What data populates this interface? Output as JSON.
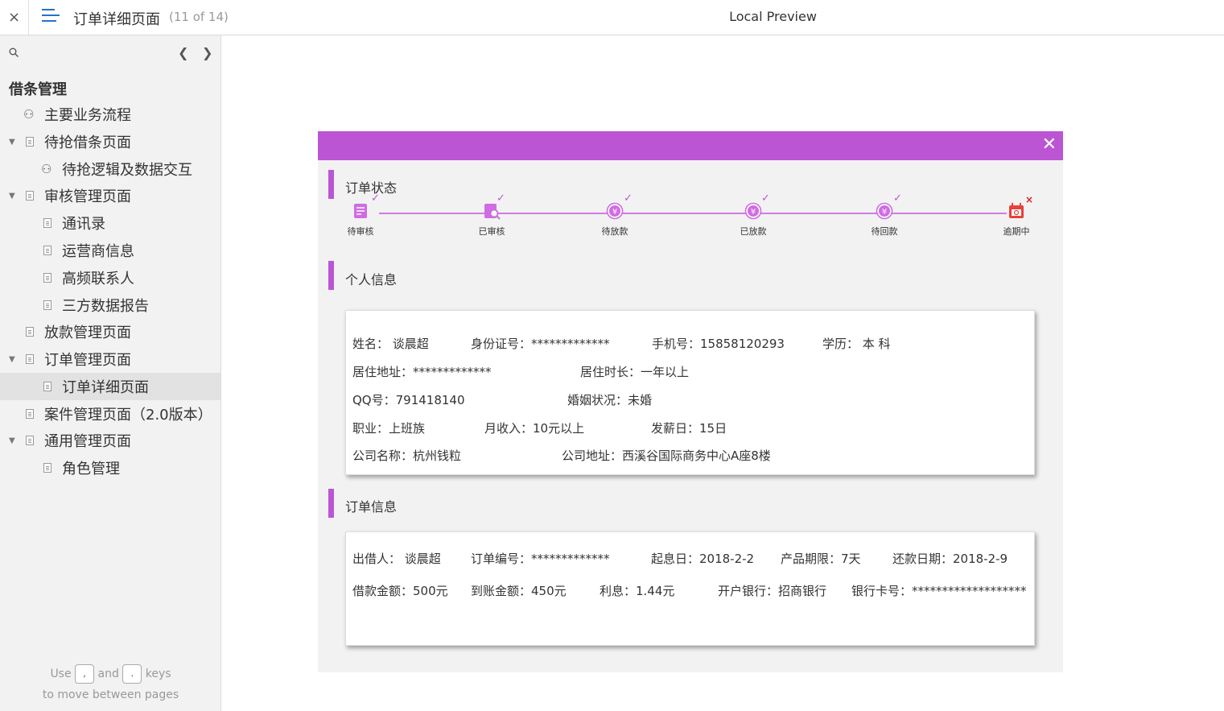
{
  "topbar": {
    "close": "×",
    "title": "订单详细页面",
    "count": "(11 of 14)",
    "preview_title": "Local Preview"
  },
  "sidebar": {
    "root": "借条管理",
    "items": [
      {
        "label": "主要业务流程"
      },
      {
        "label": "待抢借条页面"
      },
      {
        "label": "待抢逻辑及数据交互"
      },
      {
        "label": "审核管理页面"
      },
      {
        "label": "通讯录"
      },
      {
        "label": "运营商信息"
      },
      {
        "label": "高频联系人"
      },
      {
        "label": "三方数据报告"
      },
      {
        "label": "放款管理页面"
      },
      {
        "label": "订单管理页面"
      },
      {
        "label": "订单详细页面"
      },
      {
        "label": "案件管理页面（2.0版本）"
      },
      {
        "label": "通用管理页面"
      },
      {
        "label": "角色管理"
      }
    ],
    "hint": {
      "use": "Use",
      "key_prev": ",",
      "and": "and",
      "key_next": ".",
      "keys": "keys",
      "line2": "to move between pages"
    }
  },
  "panel": {
    "close": "✕",
    "accent": "#bb55d4",
    "status": {
      "title": "订单状态",
      "steps": [
        {
          "label": "待审核",
          "icon": "document-check-icon",
          "done": "✓"
        },
        {
          "label": "已审核",
          "icon": "document-search-icon",
          "done": "✓"
        },
        {
          "label": "待放款",
          "icon": "yen-coin-icon",
          "done": "✓"
        },
        {
          "label": "已放款",
          "icon": "yen-coin-icon",
          "done": "✓"
        },
        {
          "label": "待回款",
          "icon": "yen-coin-icon",
          "done": "✓"
        },
        {
          "label": "逾期中",
          "icon": "calendar-overdue-icon",
          "done": "×"
        }
      ]
    },
    "personal": {
      "title": "个人信息",
      "name": "姓名：  谈晨超",
      "id": "身份证号：*************",
      "phone": "手机号：15858120293",
      "edu": "学历：  本    科",
      "addr": "居住地址：*************",
      "duration": "居住时长：一年以上",
      "qq": "QQ号：791418140",
      "marital": "婚姻状况：未婚",
      "job": "职业：上班族",
      "income": "月收入：10元以上",
      "payday": "发薪日：15日",
      "company": "公司名称：杭州钱粒",
      "company_addr": "公司地址：西溪谷国际商务中心A座8楼"
    },
    "order": {
      "title": "订单信息",
      "lender": "出借人：  谈晨超",
      "order_no": "订单编号：*************",
      "start": "起息日：2018-2-2",
      "term": "产品期限：7天",
      "repay": "还款日期：2018-2-9",
      "amount": "借款金额：500元",
      "received": "到账金额：450元",
      "interest": "利息：1.44元",
      "bank": "开户银行：招商银行",
      "card": "银行卡号：*******************"
    }
  }
}
